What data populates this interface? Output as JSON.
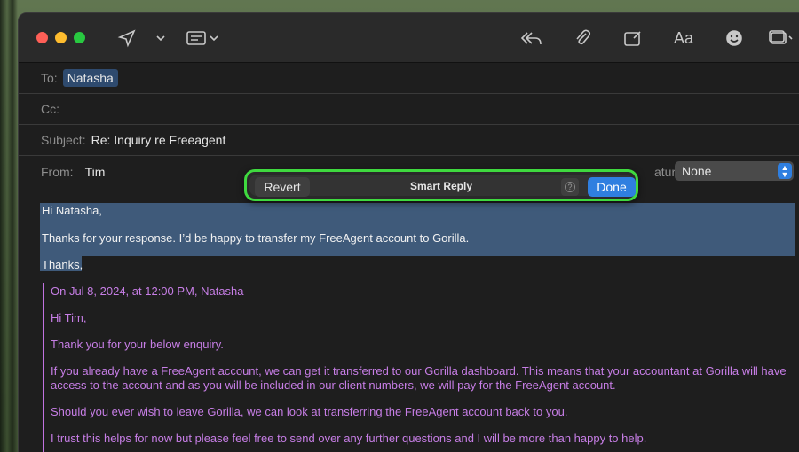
{
  "toolbar": {
    "icons": [
      "send-icon",
      "chevron-down-icon",
      "header-fields-icon",
      "reply-icon",
      "attachment-icon",
      "markup-icon",
      "format-icon",
      "emoji-icon",
      "photo-browser-icon"
    ],
    "format_label": "Aa"
  },
  "header": {
    "to_label": "To:",
    "to_value": "Natasha",
    "cc_label": "Cc:",
    "subject_label": "Subject:",
    "subject_value": "Re: Inquiry re Freeagent",
    "from_label": "From:",
    "from_value": "Tim",
    "signature_label": "ature:",
    "signature_value": "None"
  },
  "smart_reply": {
    "revert_label": "Revert",
    "title": "Smart Reply",
    "help_label": "?",
    "done_label": "Done",
    "highlight_color": "#3fd93f"
  },
  "reply": {
    "greeting": "Hi Natasha,",
    "line1": "Thanks for your response. I’d be happy to transfer my FreeAgent account to Gorilla.",
    "closing": "Thanks,"
  },
  "quoted": {
    "attribution": "On Jul 8, 2024, at 12:00 PM, Natasha",
    "greeting": "Hi Tim,",
    "p1": "Thank you for your below enquiry.",
    "p2": "If you already have a FreeAgent account, we can get it transferred to our Gorilla dashboard. This means that your accountant at Gorilla will have access to the account and as you will be included in our client numbers, we will pay for the FreeAgent account.",
    "p3": "Should you ever wish to leave Gorilla, we can look at transferring the FreeAgent account back to you.",
    "p4": "I trust this helps for now but please feel free to send over any further questions and I will be more than happy to help.",
    "color": "#c77ee6"
  }
}
